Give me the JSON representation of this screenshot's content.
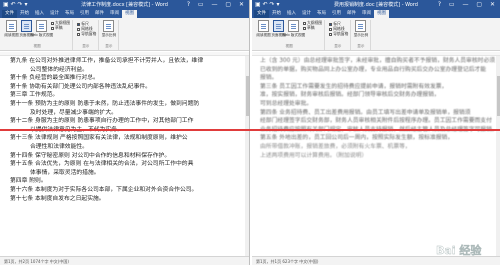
{
  "left_window": {
    "title": "法律工作制度.docx [兼容模式] - Word",
    "qat": "▣ ↶ ↷ ▾",
    "controls": "? ▭ — ▢ ✕",
    "tabs": [
      "文件",
      "开始",
      "插入",
      "设计",
      "布局",
      "引用",
      "邮件",
      "审阅",
      "视图"
    ],
    "active_tab": "视图",
    "ribbon": {
      "views_buttons": [
        "阅读视图",
        "页面视图",
        "Web 版式视图"
      ],
      "checks": [
        "大纲视图",
        "草稿"
      ],
      "views_group": "视图",
      "show_checks": [
        "标尺",
        "网格线",
        "导航窗格"
      ],
      "show_group": "显示",
      "zoom_button": "显示比例",
      "zoom_group": "显示"
    },
    "paragraphs": [
      "第九条  在公司对外推进律师工作，推备公司承担不计劳并人，且依法，维律",
      "公司整体的经济利益。",
      "第十条  负经营的最全面推行对总。",
      "第十条  协助有关部门处理公司内部各种违法乱纪事件。",
      "第三章  工作规范。",
      "第十一条  预防为主的原则  防患于未然，防止违法事件的发生，做到问题防",
      "及时处理，尽量减少事端的扩大。",
      "第十二条  身服为主的原则  防患事项自行办理的工作中，对其他部门工作",
      "以提供法律意见为主，不代为实务。",
      "第十三条  法律规则  严格按照国家有关法律，法规和制度原则，维护公",
      "合理性和法律效能性。",
      "第十四条  保守秘密原则  对公司中合作的信息和材料保存作护。",
      "第十五条  合法优先，为原则  在与法律相关的合法，对公司所工作中的具",
      "体事情，采取灵活的措施。",
      "第四章  附则。",
      "第十六条  本制度为对于实际各公司本部，下属企业和对外合资合作公司。",
      "第十七条  本制度自发布之日起实施。"
    ],
    "status": "第1页，共2页   1074个字   中文(中国)"
  },
  "right_window": {
    "title": "费用报销制度.doc [兼容模式] - Word",
    "qat": "▣ ↶ ↷ ▾",
    "controls": "? ▭ — ▢ ✕",
    "tabs": [
      "文件",
      "开始",
      "插入",
      "设计",
      "布局",
      "引用",
      "邮件",
      "审阅",
      "视图"
    ],
    "active_tab": "视图",
    "ribbon": {
      "views_buttons": [
        "阅读视图",
        "页面视图",
        "Web 版式视图"
      ],
      "checks": [
        "大纲视图",
        "草稿"
      ],
      "views_group": "视图",
      "show_checks": [
        "标尺",
        "网格线",
        "导航窗格"
      ],
      "show_group": "显示",
      "zoom_button": "显示比例",
      "zoom_group": "显示"
    },
    "paragraphs": [
      "上（含 300 元）由总经理审批签字，未经审批，擅自购买者不予报销，财务人员审核时必须",
      "已收到的单据，购买物品同上办公室办理，专业用品自行购买后交办公室办理登记后才能",
      "报销。",
      "第三条  员工因工作需要发生的招待费应提前申请，报销时需附有效发票，",
      "准，按实报销，财务审核后报销。经部门领导审核后交财务办理报销，",
      "可到总经理处审批。",
      "第四条  业务招待费、员工出差费用报销。由员工填写出差申请单及报销单，报销须",
      "经部门经理签字后交财务部，财务人员审核相关附件后按程序办理。员工因工作需要而支付",
      "业务招待费应按照有关部门规定，审核人员支持报销，然后经主管人员及总经理签字可报销。",
      "第五条  外地出差的，员工回公司后一周内，按照实际发生额，按标准报销，",
      "由所带借款冲账，报销差旅费，必须附有火车票、机票等，",
      "上述两项费用可以计算费用。（附加说明）"
    ],
    "status": "第1页，共1页   623个字   中文(中国)"
  },
  "watermark_text": "Bai 经验",
  "accent_color": "#2b579a",
  "divider_color": "#e03b3b"
}
